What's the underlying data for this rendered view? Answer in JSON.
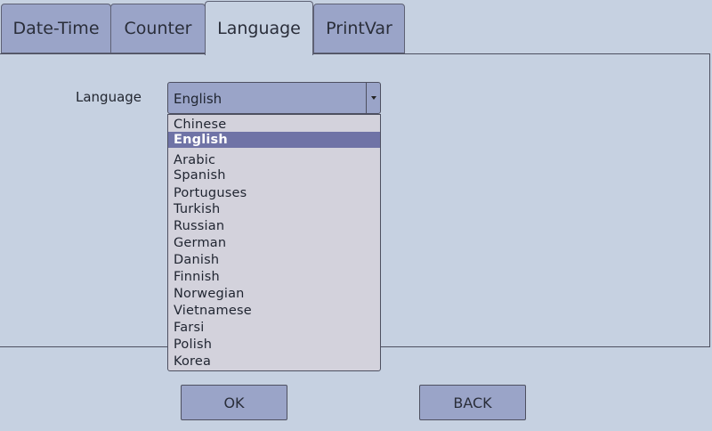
{
  "tabs": [
    {
      "label": "Date-Time"
    },
    {
      "label": "Counter"
    },
    {
      "label": "Language"
    },
    {
      "label": "PrintVar"
    }
  ],
  "language_field": {
    "label": "Language",
    "value": "English"
  },
  "language_options": [
    "Chinese",
    "English",
    "Arabic",
    "Spanish",
    "Portuguses",
    "Turkish",
    "Russian",
    "German",
    "Danish",
    "Finnish",
    "Norwegian",
    "Vietnamese",
    "Farsi",
    "Polish",
    "Korea"
  ],
  "selected_option": "English",
  "buttons": {
    "ok": "OK",
    "back": "BACK"
  },
  "colors": {
    "background": "#c6d1e1",
    "control": "#9aa4c8",
    "selection": "#6f73a6"
  }
}
